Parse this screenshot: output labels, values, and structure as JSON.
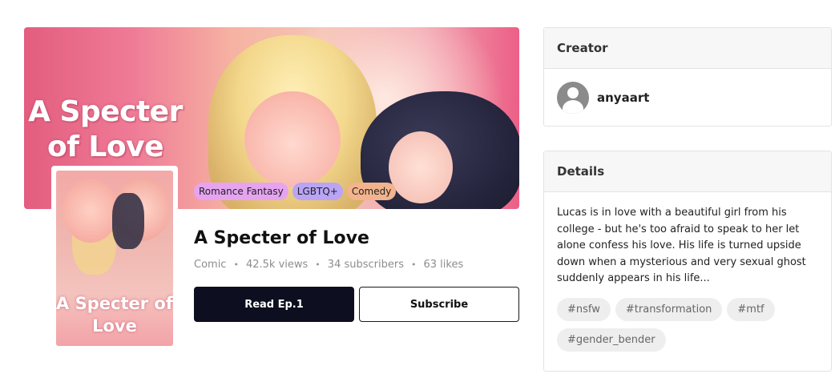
{
  "banner": {
    "art_title": "A Specter of Love",
    "genres": [
      "Romance Fantasy",
      "LGBTQ+",
      "Comedy"
    ]
  },
  "cover": {
    "art_title": "A Specter of Love"
  },
  "series": {
    "title": "A Specter of Love",
    "type": "Comic",
    "views": "42.5k views",
    "subscribers": "34 subscribers",
    "likes": "63 likes",
    "dot": "•"
  },
  "actions": {
    "read_label": "Read Ep.1",
    "subscribe_label": "Subscribe"
  },
  "creator_panel": {
    "heading": "Creator",
    "name": "anyaart"
  },
  "details_panel": {
    "heading": "Details",
    "description": "Lucas is in love with a beautiful girl from his college - but he's too afraid to speak to her let alone confess his love. His life is turned upside down when a mysterious and very sexual ghost suddenly appears in his life...",
    "hashtags": [
      "#nsfw",
      "#transformation",
      "#mtf",
      "#gender_bender"
    ]
  },
  "colors": {
    "primary_button": "#0d0e1f",
    "genre_romance": "#e6a4f0",
    "genre_lgbtq": "#b9a4f6",
    "genre_comedy": "#f2b38d"
  }
}
